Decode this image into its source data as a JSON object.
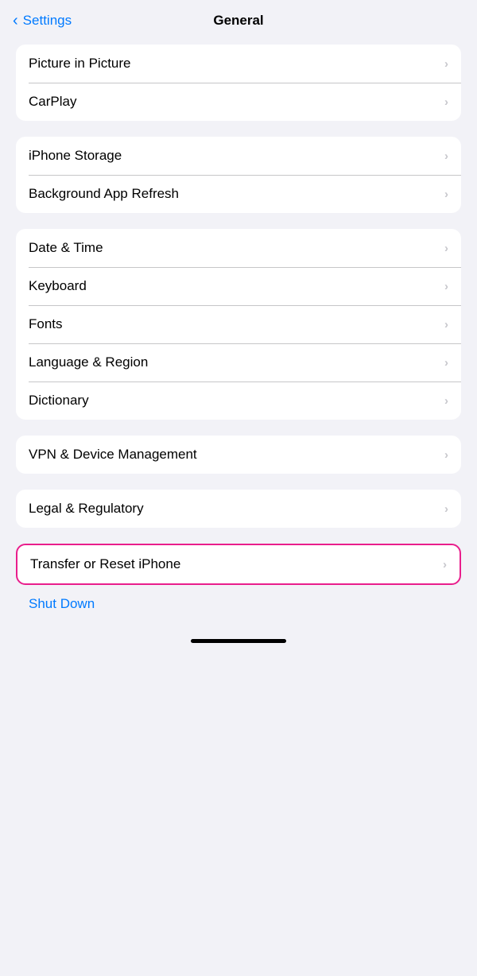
{
  "header": {
    "back_label": "Settings",
    "title": "General"
  },
  "groups": [
    {
      "id": "group1",
      "items": [
        {
          "id": "picture-in-picture",
          "label": "Picture in Picture"
        },
        {
          "id": "carplay",
          "label": "CarPlay"
        }
      ]
    },
    {
      "id": "group2",
      "items": [
        {
          "id": "iphone-storage",
          "label": "iPhone Storage"
        },
        {
          "id": "background-app-refresh",
          "label": "Background App Refresh"
        }
      ]
    },
    {
      "id": "group3",
      "items": [
        {
          "id": "date-time",
          "label": "Date & Time"
        },
        {
          "id": "keyboard",
          "label": "Keyboard"
        },
        {
          "id": "fonts",
          "label": "Fonts"
        },
        {
          "id": "language-region",
          "label": "Language & Region"
        },
        {
          "id": "dictionary",
          "label": "Dictionary"
        }
      ]
    },
    {
      "id": "group4",
      "items": [
        {
          "id": "vpn-device-management",
          "label": "VPN & Device Management"
        }
      ]
    },
    {
      "id": "group5",
      "items": [
        {
          "id": "legal-regulatory",
          "label": "Legal & Regulatory"
        }
      ]
    }
  ],
  "highlighted_item": {
    "label": "Transfer or Reset iPhone"
  },
  "shut_down": {
    "label": "Shut Down"
  },
  "icons": {
    "back_chevron": "‹",
    "chevron_right": "›"
  }
}
